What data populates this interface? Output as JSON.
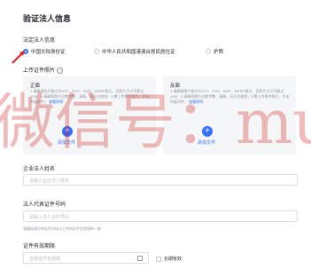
{
  "section_title": "验证法人信息",
  "legal_person_info_label": "法定法人信息",
  "id_type_options": [
    {
      "label": "中国大陆身份证",
      "selected": true
    },
    {
      "label": "中华人民共和国港澳台居民居住证",
      "selected": false
    },
    {
      "label": "护照",
      "selected": false
    }
  ],
  "upload_label": "上传证件照片",
  "front_card": {
    "title": "正面",
    "tips": "1.请确保图片格式为JPG、PNG、BMP、WEBP格式，且图片大小不超过10M；2.请确保照片边缘完整、清晰，无反光遮挡；3.需上传原件照片，不支持复印件；",
    "tips_link": "查看样例",
    "add_label": "添加文件"
  },
  "back_card": {
    "title": "反面",
    "tips": "1.请确保图片格式为JPG、PNG、BMP、WEBP格式，且图片大小不超过10M；2.请确保照片边缘完整、清晰，无反光遮挡；3.需上传原件照片，不支持复印件；",
    "tips_link": "查看样例",
    "add_label": "添加文件"
  },
  "legal_name_label": "企业法人姓名",
  "legal_name_placeholder": "请输入企业法人姓名",
  "id_number_label": "法人代表证件号码",
  "id_number_placeholder": "请输入法人证件号码",
  "id_number_hint": "请确保填写的证件号码与上传的证件信息保持一致",
  "validity_label": "证件有效期限",
  "validity_placeholder": "选择证件有效期",
  "long_term_label": "长期有效",
  "watermark_text": "微信号：multiandc",
  "colors": {
    "accent": "#3370ff",
    "watermark": "#cd1e1e",
    "card_bg": "#f5f6f7"
  },
  "icons": {
    "add": "plus-icon",
    "calendar": "calendar-icon",
    "help": "question-icon"
  }
}
